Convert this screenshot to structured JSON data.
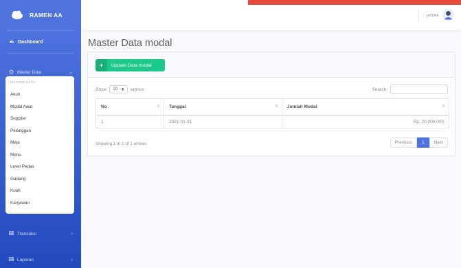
{
  "brand": {
    "name": "RAMEN AA",
    "icon": "cloud-icon"
  },
  "sidebar": {
    "dashboard": {
      "label": "Dashboard",
      "icon": "tachometer-icon"
    },
    "master": {
      "label": "Master Data",
      "icon": "gear-icon",
      "expanded": true
    },
    "submenu_header": "MASTER DATA:",
    "submenu_items": [
      {
        "label": "Akun"
      },
      {
        "label": "Modal Awal"
      },
      {
        "label": "Supplier"
      },
      {
        "label": "Pelanggan"
      },
      {
        "label": "Meja"
      },
      {
        "label": "Menu"
      },
      {
        "label": "Level Pedas"
      },
      {
        "label": "Gudang"
      },
      {
        "label": "Kuah"
      },
      {
        "label": "Karyawan"
      }
    ],
    "transaksi": {
      "label": "Transaksi",
      "icon": "table-icon"
    },
    "laporan": {
      "label": "Laporan",
      "icon": "table-icon"
    }
  },
  "topbar": {
    "user_name": "pemilik"
  },
  "page": {
    "title": "Master Data modal"
  },
  "card": {
    "button_label": "Update Data modal",
    "show_label": "Show",
    "entries_value": "10",
    "entries_label": "entries",
    "search_label": "Search:",
    "search_value": "",
    "columns": [
      "No",
      "Tanggal",
      "Jumlah Modal"
    ],
    "rows": [
      {
        "no": "1",
        "tanggal": "2021-01-01",
        "jumlah": "Rp. 20.000.000"
      }
    ],
    "info": "Showing 1 to 1 of 1 entries",
    "pagination": {
      "previous": "Previous",
      "current": "1",
      "next": "Next"
    }
  },
  "colors": {
    "sidebar": "#4e73df",
    "accent_red": "#e74a3b",
    "success": "#1cc88a",
    "primary": "#4e73df"
  }
}
